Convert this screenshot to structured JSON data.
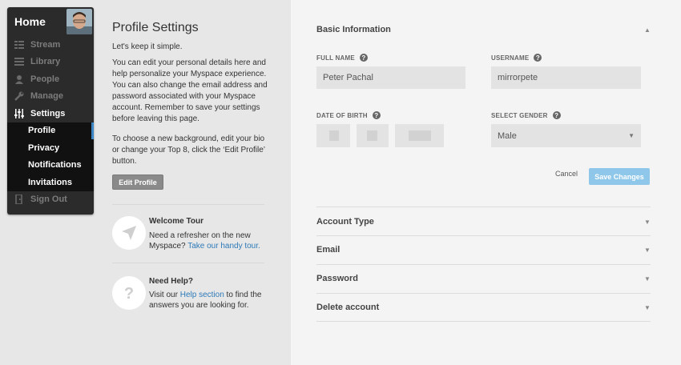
{
  "nav": {
    "home": "Home",
    "items": [
      {
        "label": "Stream",
        "icon": "stream-icon"
      },
      {
        "label": "Library",
        "icon": "library-icon"
      },
      {
        "label": "People",
        "icon": "people-icon"
      },
      {
        "label": "Manage",
        "icon": "wrench-icon"
      },
      {
        "label": "Settings",
        "icon": "sliders-icon"
      }
    ],
    "sub": [
      "Profile",
      "Privacy",
      "Notifications",
      "Invitations"
    ],
    "signout": "Sign Out"
  },
  "info": {
    "title": "Profile Settings",
    "subtitle": "Let's keep it simple.",
    "para1": "You can edit your personal details here and help personalize your Myspace experience. You can also change the email address and password associated with your Myspace account. Remember to save your settings before leaving this page.",
    "para2": "To choose a new background, edit your bio or change your Top 8, click the ‘Edit Profile’ button.",
    "edit_button": "Edit Profile",
    "tour_title": "Welcome Tour",
    "tour_text": "Need a refresher on the new Myspace? ",
    "tour_link": "Take our handy tour.",
    "help_title": "Need Help?",
    "help_pre": "Visit our ",
    "help_link": "Help section",
    "help_post": " to find the answers you are looking for."
  },
  "form": {
    "section_basic": "Basic Information",
    "full_name_label": "FULL NAME",
    "full_name_value": "Peter Pachal",
    "username_label": "USERNAME",
    "username_value": "mirrorpete",
    "dob_label": "DATE OF BIRTH",
    "gender_label": "SELECT GENDER",
    "gender_value": "Male",
    "cancel": "Cancel",
    "save": "Save Changes",
    "sections": [
      "Account Type",
      "Email",
      "Password",
      "Delete account"
    ]
  },
  "colors": {
    "accent": "#3d86c6",
    "save": "#8ec7ea",
    "nav_bg": "#2b2b2b"
  }
}
